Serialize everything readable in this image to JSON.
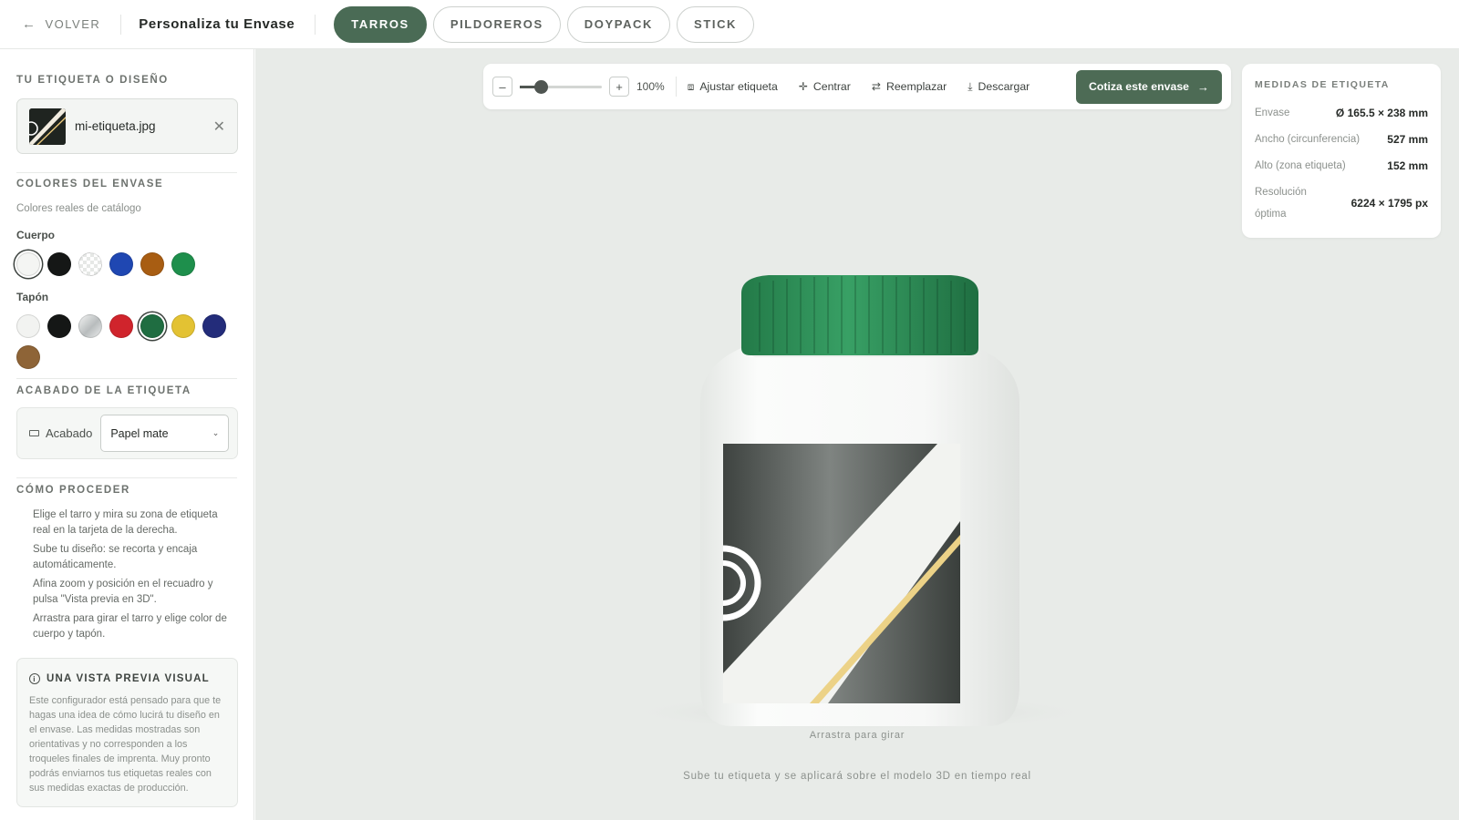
{
  "header": {
    "back_label": "VOLVER",
    "title": "Personaliza tu Envase",
    "tabs": [
      {
        "label": "TARROS",
        "active": true
      },
      {
        "label": "PILDOREROS",
        "active": false
      },
      {
        "label": "DOYPACK",
        "active": false
      },
      {
        "label": "STICK",
        "active": false
      }
    ]
  },
  "sidebar": {
    "design_title": "TU ETIQUETA O DISEÑO",
    "file_name": "mi-etiqueta.jpg",
    "colors_title": "COLORES DEL ENVASE",
    "colors_subtitle": "Colores reales de catálogo",
    "body_label": "Cuerpo",
    "body_colors": [
      "#f4f5f3",
      "#151716",
      "checker",
      "#1f47b2",
      "#a85d12",
      "#1e8f4c"
    ],
    "body_selected": 0,
    "cap_label": "Tapón",
    "cap_colors": [
      "#f2f3f1",
      "#151716",
      "silver",
      "#d0242c",
      "#1f6d41",
      "#e3c233",
      "#232c7a",
      "#8e6437"
    ],
    "cap_selected": 4,
    "finish_title": "ACABADO DE LA ETIQUETA",
    "finish_label": "Acabado",
    "finish_value": "Papel mate",
    "how_title": "CÓMO PROCEDER",
    "steps": [
      "Elige el tarro y mira su zona de etiqueta real en la tarjeta de la derecha.",
      "Sube tu diseño: se recorta y encaja automáticamente.",
      "Afina zoom y posición en el recuadro y pulsa \"Vista previa en 3D\".",
      "Arrastra para girar el tarro y elige color de cuerpo y tapón."
    ],
    "info_title": "UNA VISTA PREVIA VISUAL",
    "info_body": "Este configurador está pensado para que te hagas una idea de cómo lucirá tu diseño en el envase. Las medidas mostradas son orientativas y no corresponden a los troqueles finales de imprenta. Muy pronto podrás enviarnos tus etiquetas reales con sus medidas exactas de producción."
  },
  "toolbar": {
    "zoom_out": "–",
    "zoom_in": "+",
    "zoom_level": 100,
    "zoom_value": "100%",
    "fit_label": "Ajustar etiqueta",
    "center_label": "Centrar",
    "replace_label": "Reemplazar",
    "download_label": "Descargar",
    "cta_label": "Cotiza este envase"
  },
  "measures": {
    "title": "MEDIDAS DE ETIQUETA",
    "rows": [
      {
        "label": "Envase",
        "value": "Ø 165.5 × 238 mm"
      },
      {
        "label": "Ancho (circunferencia)",
        "value": "527 mm"
      },
      {
        "label": "Alto (zona etiqueta)",
        "value": "152 mm"
      },
      {
        "label": "Resolución óptima",
        "value": "6224 × 1795 px"
      }
    ]
  },
  "canvas": {
    "drag_hint": "Arrastra para girar",
    "upload_hint": "Sube tu etiqueta y se aplicará sobre el modelo 3D en tiempo real"
  },
  "icons": {
    "back": "arrow-left-icon",
    "close": "close-icon",
    "finish": "label-rect-icon",
    "info": "info-icon",
    "fit": "fit-frame-icon",
    "center": "crosshair-icon",
    "replace": "replace-icon",
    "download": "download-icon",
    "cta_arrow": "arrow-right-icon",
    "chevron": "chevron-down-icon"
  },
  "colors": {
    "accent": "#4a6b55",
    "canvas_bg": "#e8ebe8"
  }
}
